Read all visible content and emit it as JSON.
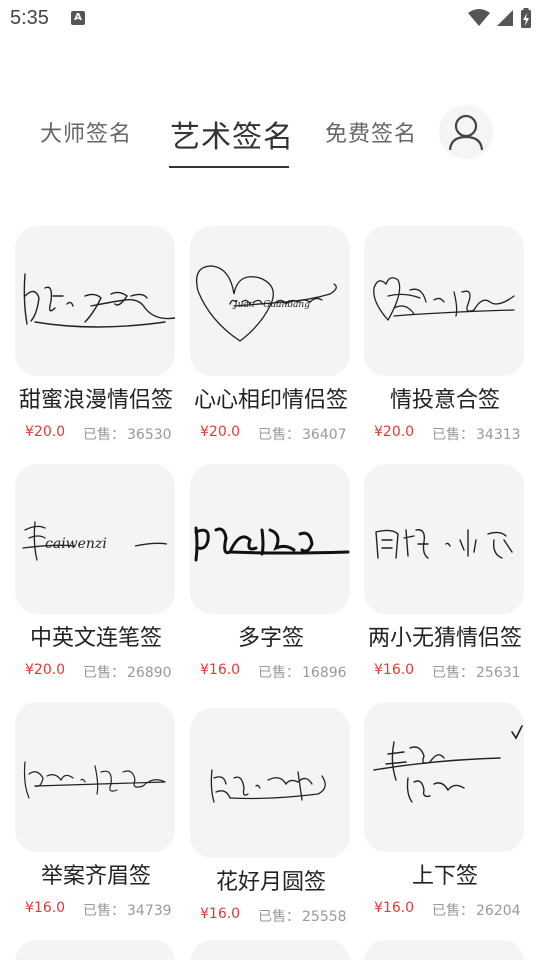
{
  "status_bar": {
    "time": "5:35",
    "notification_icon": "A"
  },
  "tabs": [
    {
      "label": "大师签名",
      "active": false
    },
    {
      "label": "艺术签名",
      "active": true
    },
    {
      "label": "免费签名",
      "active": false
    }
  ],
  "products": [
    {
      "title": "甜蜜浪漫情侣签",
      "price": "¥20.0",
      "sold_label": "已售：",
      "sold": "36530"
    },
    {
      "title": "心心相印情侣签",
      "price": "¥20.0",
      "sold_label": "已售：",
      "sold": "36407"
    },
    {
      "title": "情投意合签",
      "price": "¥20.0",
      "sold_label": "已售：",
      "sold": "34313"
    },
    {
      "title": "中英文连笔签",
      "price": "¥20.0",
      "sold_label": "已售：",
      "sold": "26890"
    },
    {
      "title": "多字签",
      "price": "¥16.0",
      "sold_label": "已售：",
      "sold": "16896"
    },
    {
      "title": "两小无猜情侣签",
      "price": "¥16.0",
      "sold_label": "已售：",
      "sold": "25631"
    },
    {
      "title": "举案齐眉签",
      "price": "¥16.0",
      "sold_label": "已售：",
      "sold": "34739"
    },
    {
      "title": "花好月圆签",
      "price": "¥16.0",
      "sold_label": "已售：",
      "sold": "25558"
    },
    {
      "title": "上下签",
      "price": "¥16.0",
      "sold_label": "已售：",
      "sold": "26204"
    }
  ],
  "colors": {
    "price": "#e53935",
    "sold": "#999999",
    "thumb_bg": "#f4f4f4"
  }
}
